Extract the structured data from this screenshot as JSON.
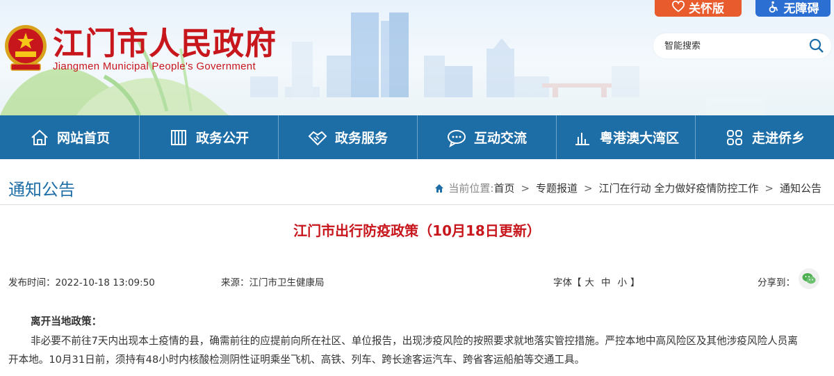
{
  "header": {
    "title": "江门市人民政府",
    "subtitle": "Jiangmen Municipal People's Government",
    "care_label": "关怀版",
    "accessibility_label": "无障碍",
    "search_placeholder": "智能搜索"
  },
  "nav": {
    "items": [
      {
        "label": "网站首页",
        "icon": "home-icon"
      },
      {
        "label": "政务公开",
        "icon": "building-icon"
      },
      {
        "label": "政务服务",
        "icon": "handshake-icon"
      },
      {
        "label": "互动交流",
        "icon": "chat-icon"
      },
      {
        "label": "粤港澳大湾区",
        "icon": "chart-icon"
      },
      {
        "label": "走进侨乡",
        "icon": "grid-icon"
      }
    ]
  },
  "section": {
    "title": "通知公告",
    "breadcrumb_prefix": "当前位置:",
    "breadcrumb": [
      "首页",
      "专题报道",
      "江门在行动 全力做好疫情防控工作",
      "通知公告"
    ]
  },
  "article": {
    "title": "江门市出行防疫政策（10月18日更新）",
    "publish_time": "发布时间：2022-10-18 13:09:50",
    "source": "来源：江门市卫生健康局",
    "font_label": "字体【",
    "font_large": "大",
    "font_medium": "中",
    "font_small": "小",
    "font_close": "】",
    "share_label": "分享到：",
    "subhead": "离开当地政策：",
    "paragraph_line1": "非必要不前往7天内出现本土疫情的县，确需前往的应提前向所在社区、单位报告，出现涉疫风险的按照要求就地落实管控措施。严控本地中高风险区及其他涉疫风险人员离",
    "paragraph_line2": "开本地。10月31日前，须持有48小时内核酸检测阴性证明乘坐飞机、高铁、列车、跨长途客运汽车、跨省客运船舶等交通工具。"
  },
  "colors": {
    "brand_red": "#c8161d",
    "nav_blue": "#1d6da6",
    "care_orange": "#e85b2c",
    "access_blue": "#2a6fd1"
  }
}
